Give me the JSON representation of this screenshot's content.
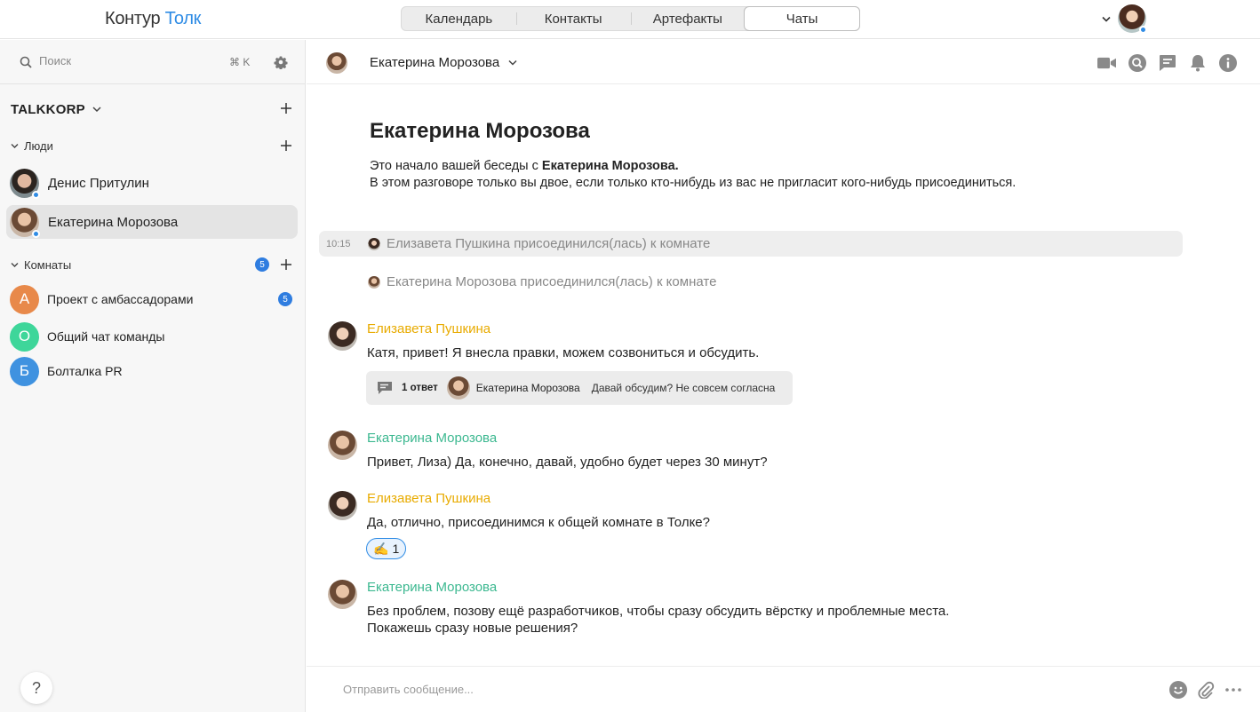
{
  "topbar": {
    "logo_primary": "Контур",
    "logo_secondary": "Толк",
    "tabs": [
      {
        "label": "Календарь",
        "active": false
      },
      {
        "label": "Контакты",
        "active": false
      },
      {
        "label": "Артефакты",
        "active": false
      },
      {
        "label": "Чаты",
        "active": true
      }
    ]
  },
  "sidebar": {
    "search_placeholder": "Поиск",
    "search_hotkey": "⌘ K",
    "org_name": "TALKKORP",
    "people_section": "Люди",
    "people": [
      {
        "name": "Денис Притулин",
        "active": false,
        "online": true
      },
      {
        "name": "Екатерина Морозова",
        "active": true,
        "online": true
      }
    ],
    "rooms_section": "Комнаты",
    "rooms_badge": "5",
    "rooms": [
      {
        "letter": "А",
        "name": "Проект с амбассадорами",
        "color": "#e8894a",
        "badge": "5"
      },
      {
        "letter": "О",
        "name": "Общий чат команды",
        "color": "#3ed69a",
        "badge": ""
      },
      {
        "letter": "Б",
        "name": "Болталка PR",
        "color": "#3f92e0",
        "badge": ""
      }
    ],
    "help_label": "?"
  },
  "chat": {
    "header_name": "Екатерина Морозова",
    "intro_title": "Екатерина Морозова",
    "intro_line1_prefix": "Это начало вашей беседы с ",
    "intro_line1_name": "Екатерина Морозова.",
    "intro_line2": "В этом разговоре только вы двое, если только кто-нибудь из вас не пригласит кого-нибудь присоединиться.",
    "system_events": [
      {
        "time": "10:15",
        "text": "Елизавета Пушкина присоединился(лась) к комнате"
      },
      {
        "time": "",
        "text": "Екатерина Морозова присоединился(лась) к комнате"
      }
    ],
    "messages": [
      {
        "sender": "Елизавета Пушкина",
        "sender_color": "#e8ab00",
        "text": "Катя, привет! Я внесла правки, можем созвониться и обсудить.",
        "thread": {
          "count_label": "1 ответ",
          "author": "Екатерина Морозова",
          "preview": "Давай обсудим? Не совсем согласна"
        }
      },
      {
        "sender": "Екатерина Морозова",
        "sender_color": "#3cb890",
        "text": "Привет, Лиза) Да, конечно, давай, удобно будет через 30 минут?"
      },
      {
        "sender": "Елизавета Пушкина",
        "sender_color": "#e8ab00",
        "text": "Да, отлично, присоединимся к общей комнате в Толке?",
        "reaction": {
          "emoji": "✍️",
          "count": "1"
        }
      },
      {
        "sender": "Екатерина Морозова",
        "sender_color": "#3cb890",
        "text_line1": "Без проблем, позову ещё разработчиков, чтобы сразу обсудить вёрстку и проблемные места.",
        "text_line2": "Покажешь сразу новые решения?"
      }
    ],
    "composer_placeholder": "Отправить сообщение..."
  }
}
